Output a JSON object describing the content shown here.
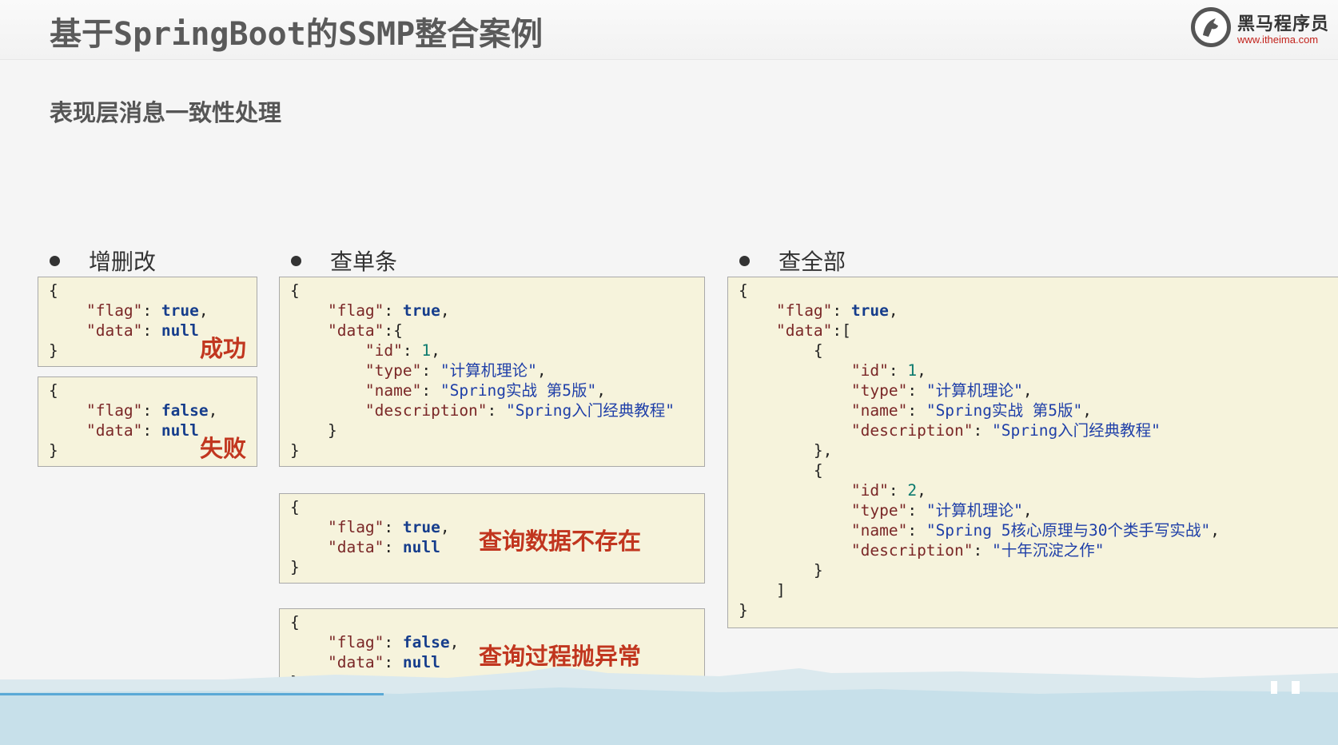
{
  "header": {
    "title": "基于SpringBoot的SSMP整合案例",
    "logo_text": "黑马程序员",
    "logo_url": "www.itheima.com",
    "logo_icon": "horse-head-logo-icon"
  },
  "subtitle": "表现层消息一致性处理",
  "sections": [
    {
      "label": "增删改"
    },
    {
      "label": "查单条"
    },
    {
      "label": "查全部"
    }
  ],
  "notes": {
    "success": "成功",
    "fail": "失败",
    "not_found": "查询数据不存在",
    "exception": "查询过程抛异常"
  },
  "code": {
    "add_success": [
      [
        "{"
      ],
      [
        "    ",
        "\"flag\"",
        ": ",
        "true",
        ","
      ],
      [
        "    ",
        "\"data\"",
        ": ",
        "null"
      ],
      [
        "}"
      ]
    ],
    "add_fail": [
      [
        "{"
      ],
      [
        "    ",
        "\"flag\"",
        ": ",
        "false",
        ","
      ],
      [
        "    ",
        "\"data\"",
        ": ",
        "null"
      ],
      [
        "}"
      ]
    ],
    "get_one": [
      [
        "{"
      ],
      [
        "    ",
        "\"flag\"",
        ": ",
        "true",
        ","
      ],
      [
        "    ",
        "\"data\"",
        ":{"
      ],
      [
        "        ",
        "\"id\"",
        ": ",
        "1",
        ","
      ],
      [
        "        ",
        "\"type\"",
        ": ",
        "\"计算机理论\"",
        ","
      ],
      [
        "        ",
        "\"name\"",
        ": ",
        "\"Spring实战 第5版\"",
        ","
      ],
      [
        "        ",
        "\"description\"",
        ": ",
        "\"Spring入门经典教程\""
      ],
      [
        "    }"
      ],
      [
        "}"
      ]
    ],
    "get_one_null": [
      [
        "{"
      ],
      [
        "    ",
        "\"flag\"",
        ": ",
        "true",
        ","
      ],
      [
        "    ",
        "\"data\"",
        ": ",
        "null"
      ],
      [
        "}"
      ]
    ],
    "get_one_error": [
      [
        "{"
      ],
      [
        "    ",
        "\"flag\"",
        ": ",
        "false",
        ","
      ],
      [
        "    ",
        "\"data\"",
        ": ",
        "null"
      ],
      [
        "}"
      ]
    ],
    "get_all": [
      [
        "{"
      ],
      [
        "    ",
        "\"flag\"",
        ": ",
        "true",
        ","
      ],
      [
        "    ",
        "\"data\"",
        ":["
      ],
      [
        "        {"
      ],
      [
        "            ",
        "\"id\"",
        ": ",
        "1",
        ","
      ],
      [
        "            ",
        "\"type\"",
        ": ",
        "\"计算机理论\"",
        ","
      ],
      [
        "            ",
        "\"name\"",
        ": ",
        "\"Spring实战 第5版\"",
        ","
      ],
      [
        "            ",
        "\"description\"",
        ": ",
        "\"Spring入门经典教程\""
      ],
      [
        "        },"
      ],
      [
        "        {"
      ],
      [
        "            ",
        "\"id\"",
        ": ",
        "2",
        ","
      ],
      [
        "            ",
        "\"type\"",
        ": ",
        "\"计算机理论\"",
        ","
      ],
      [
        "            ",
        "\"name\"",
        ": ",
        "\"Spring 5核心原理与30个类手写实战\"",
        ","
      ],
      [
        "            ",
        "\"description\"",
        ": ",
        "\"十年沉淀之作\""
      ],
      [
        "        }"
      ],
      [
        "    ]"
      ],
      [
        "}"
      ]
    ]
  },
  "colors": {
    "code_background": "#f6f3dc",
    "note_red": "#c1361f",
    "key": "#7a2727",
    "literal": "#163d8c"
  }
}
